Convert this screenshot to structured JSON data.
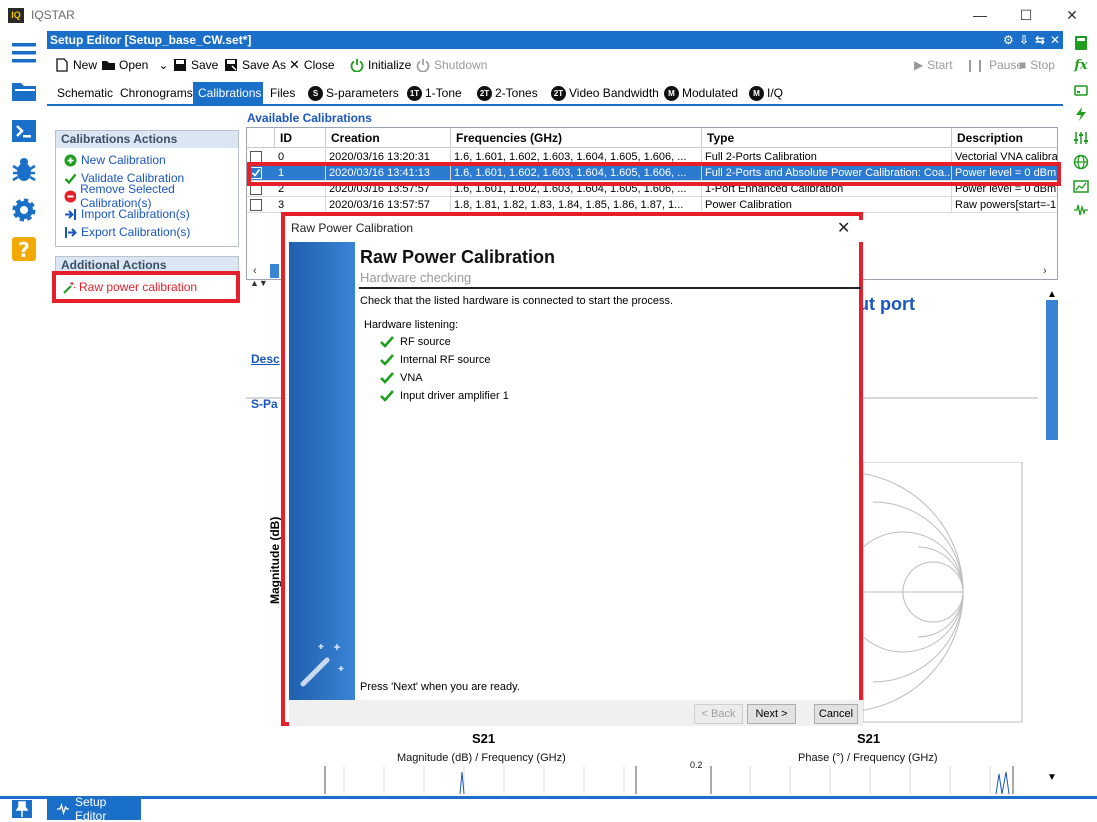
{
  "app": {
    "logo": "IQ",
    "title": "IQSTAR"
  },
  "window_controls": {
    "minimize": "—",
    "maximize": "☐",
    "close": "✕"
  },
  "editor": {
    "title": "Setup Editor [Setup_base_CW.set*]",
    "header_icons": [
      "gear-icon",
      "download-icon",
      "split-icon",
      "close-icon"
    ]
  },
  "toolbar": {
    "new": "New",
    "open": "Open",
    "save": "Save",
    "save_as": "Save As",
    "close": "Close",
    "initialize": "Initialize",
    "shutdown": "Shutdown",
    "start": "Start",
    "pause": "Pause",
    "stop": "Stop"
  },
  "tabs": {
    "schematic": "Schematic",
    "chronograms": "Chronograms",
    "calibrations": "Calibrations",
    "files": "Files",
    "s_parameters": "S-parameters",
    "one_tone": "1-Tone",
    "two_tones": "2-Tones",
    "video_bandwidth": "Video Bandwidth",
    "modulated": "Modulated",
    "iq": "I/Q",
    "badges": {
      "s": "S",
      "one_t": "1T",
      "two_t": "2T",
      "two_t_b": "2T",
      "m": "M",
      "iq": "M"
    }
  },
  "calibration_actions": {
    "heading": "Calibrations Actions",
    "items": [
      "New Calibration",
      "Validate Calibration",
      "Remove Selected Calibration(s)",
      "Import Calibration(s)",
      "Export Calibration(s)"
    ]
  },
  "additional_actions": {
    "heading": "Additional Actions",
    "raw_power": "Raw power calibration"
  },
  "available_calibrations": {
    "title": "Available Calibrations",
    "columns": [
      "ID",
      "Creation",
      "Frequencies (GHz)",
      "Type",
      "Description"
    ],
    "rows": [
      {
        "id": "0",
        "creation": "2020/03/16 13:20:31",
        "freq": "1.6, 1.601, 1.602, 1.603, 1.604, 1.605, 1.606, ...",
        "type": "Full 2-Ports Calibration",
        "desc": "Vectorial VNA calibrati",
        "checked": false
      },
      {
        "id": "1",
        "creation": "2020/03/16 13:41:13",
        "freq": "1.6, 1.601, 1.602, 1.603, 1.604, 1.605, 1.606, ...",
        "type": "Full 2-Ports and Absolute Power Calibration: Coa...",
        "desc": "Power level = 0 dBm,",
        "checked": true
      },
      {
        "id": "2",
        "creation": "2020/03/16 13:57:57",
        "freq": "1.6, 1.601, 1.602, 1.603, 1.604, 1.605, 1.606, ...",
        "type": "1-Port Enhanced Calibration",
        "desc": "Power level = 0 dBm,",
        "checked": false
      },
      {
        "id": "3",
        "creation": "2020/03/16 13:57:57",
        "freq": "1.8, 1.81, 1.82, 1.83, 1.84, 1.85, 1.86, 1.87, 1...",
        "type": "Power Calibration",
        "desc": "Raw powers[start=-1",
        "checked": false
      }
    ]
  },
  "background": {
    "output_port": "ut port",
    "desc_link": "Desc",
    "s_pa_link": "S-Pa",
    "magnitude_axis": "Magnitude (dB)",
    "s21_left": "S21",
    "s21_right": "S21",
    "chart_left_title": "Magnitude (dB) / Frequency (GHz)",
    "chart_right_title": "Phase (°) / Frequency (GHz)",
    "tick_02": "0.2"
  },
  "dialog": {
    "window_title": "Raw Power Calibration",
    "heading": "Raw Power Calibration",
    "subheading": "Hardware checking",
    "instruction": "Check that the listed hardware is connected to start the process.",
    "hardware_label": "Hardware listening:",
    "hardware": [
      "RF source",
      "Internal RF source",
      "VNA",
      "Input driver amplifier 1"
    ],
    "footer": "Press 'Next' when you are ready.",
    "back": "< Back",
    "next": "Next >",
    "cancel": "Cancel"
  },
  "bottom": {
    "tab": "Setup Editor"
  },
  "colors": {
    "accent": "#1a6fc9",
    "highlight": "#e5202b",
    "link": "#1a56c0",
    "check": "#1e9e1e"
  }
}
